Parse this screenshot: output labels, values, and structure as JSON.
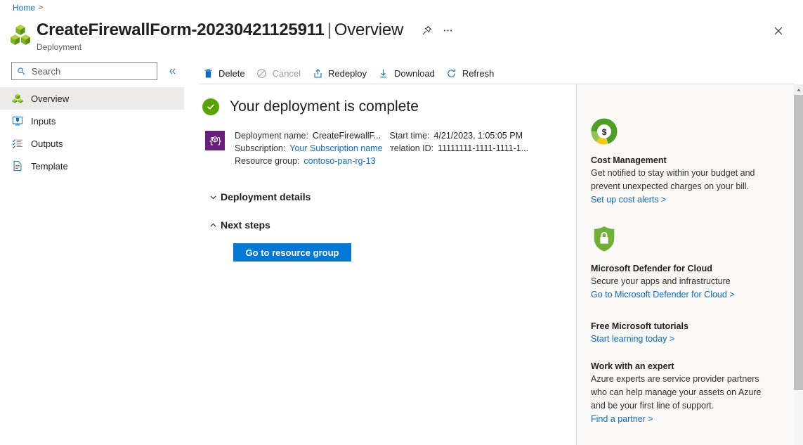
{
  "breadcrumb": {
    "home": "Home",
    "separator": ">"
  },
  "header": {
    "title": "CreateFirewallForm-20230421125911",
    "separator": "|",
    "subtitle_section": "Overview",
    "resource_type": "Deployment",
    "pin_icon": "pin-icon",
    "more_icon": "ellipsis-icon",
    "close_icon": "close-icon",
    "resource_icon": "deployment-cubes-icon"
  },
  "sidebar": {
    "search": {
      "placeholder": "Search",
      "value": "",
      "icon": "search-icon"
    },
    "collapse_icon": "double-chevron-left-icon",
    "items": [
      {
        "label": "Overview",
        "icon": "overview-cubes-icon",
        "selected": true
      },
      {
        "label": "Inputs",
        "icon": "inputs-icon",
        "selected": false
      },
      {
        "label": "Outputs",
        "icon": "outputs-list-icon",
        "selected": false
      },
      {
        "label": "Template",
        "icon": "template-document-icon",
        "selected": false
      }
    ]
  },
  "command_bar": {
    "commands": [
      {
        "label": "Delete",
        "icon": "trash-icon",
        "disabled": false
      },
      {
        "label": "Cancel",
        "icon": "cancel-circle-icon",
        "disabled": true
      },
      {
        "label": "Redeploy",
        "icon": "upload-box-icon",
        "disabled": false
      },
      {
        "label": "Download",
        "icon": "download-arrow-icon",
        "disabled": false
      },
      {
        "label": "Refresh",
        "icon": "refresh-icon",
        "disabled": false
      }
    ]
  },
  "main": {
    "status_title": "Your deployment is complete",
    "status_icon": "success-check-icon",
    "deployment_icon": "deployment-template-icon",
    "info_left": [
      {
        "label": "Deployment name:",
        "value": "CreateFirewallF...",
        "is_link": false
      },
      {
        "label": "Subscription:",
        "value": "Your Subscription name",
        "is_link": true
      },
      {
        "label": "Resource group:",
        "value": "contoso-pan-rg-13",
        "is_link": true
      }
    ],
    "info_right": [
      {
        "label": "Start time:",
        "value": "4/21/2023, 1:05:05 PM",
        "is_link": false
      },
      {
        "label": "orrelation ID:",
        "value": "11111111-1111-1111-1...",
        "is_link": false
      }
    ],
    "accordions": [
      {
        "label": "Deployment details",
        "expanded": false,
        "chevron": "chevron-down-icon"
      },
      {
        "label": "Next steps",
        "expanded": true,
        "chevron": "chevron-up-icon"
      }
    ],
    "primary_button": "Go to resource group"
  },
  "right_panel": {
    "cards": [
      {
        "icon": "cost-donut-icon",
        "title": "Cost Management",
        "lines": [
          "Get notified to stay within your budget and",
          "prevent unexpected charges on your bill."
        ],
        "link": "Set up cost alerts >"
      },
      {
        "icon": "shield-lock-icon",
        "title": "Microsoft Defender for Cloud",
        "lines": [
          "Secure your apps and infrastructure"
        ],
        "link": "Go to Microsoft Defender for Cloud >"
      },
      {
        "icon": null,
        "title": "Free Microsoft tutorials",
        "lines": [],
        "link": "Start learning today >"
      },
      {
        "icon": null,
        "title": "Work with an expert",
        "lines": [
          "Azure experts are service provider partners",
          "who can help manage your assets on Azure",
          "and be your first line of support."
        ],
        "link": "Find a partner >"
      }
    ]
  },
  "scrollbar": {
    "up_icon": "scroll-up-arrow-icon"
  },
  "colors": {
    "accent_blue": "#0078d4",
    "link_blue": "#0f6cbd",
    "success_green": "#57a300",
    "deployment_purple": "#68217a",
    "panel_bg": "#faf9f8",
    "selected_nav": "#edebe9"
  }
}
